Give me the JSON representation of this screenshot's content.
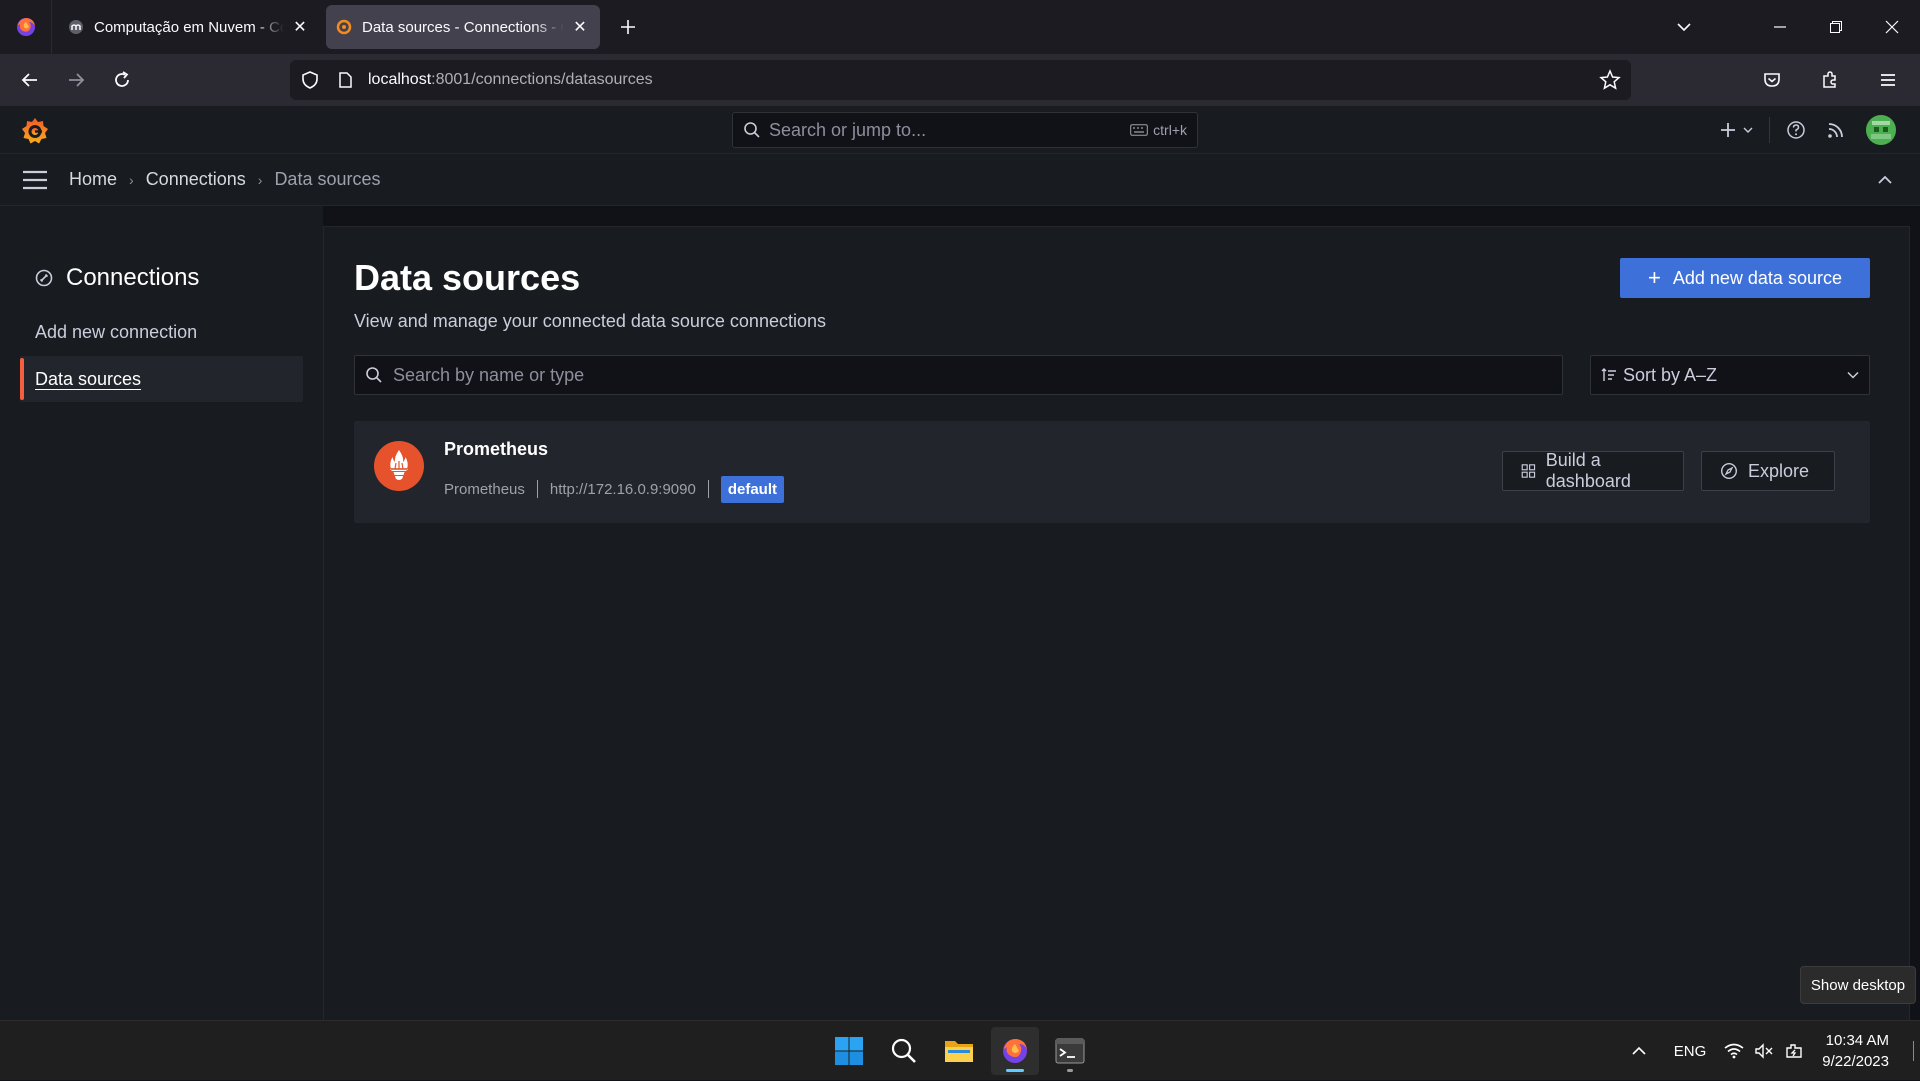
{
  "browser": {
    "tabs": [
      {
        "title": "Computação em Nuvem - Comp",
        "active": false
      },
      {
        "title": "Data sources - Connections - Grafana",
        "active": true
      }
    ],
    "url_host": "localhost",
    "url_path": ":8001/connections/datasources"
  },
  "grafana": {
    "search_placeholder": "Search or jump to...",
    "search_shortcut": "ctrl+k",
    "breadcrumbs": [
      "Home",
      "Connections",
      "Data sources"
    ],
    "sidebar": {
      "title": "Connections",
      "items": [
        {
          "label": "Add new connection",
          "active": false
        },
        {
          "label": "Data sources",
          "active": true
        }
      ]
    },
    "page": {
      "title": "Data sources",
      "subtitle": "View and manage your connected data source connections",
      "add_button": "Add new data source",
      "search_placeholder": "Search by name or type",
      "sort_label": "Sort by A–Z"
    },
    "datasources": [
      {
        "name": "Prometheus",
        "type": "Prometheus",
        "url": "http://172.16.0.9:9090",
        "badge": "default",
        "build_label": "Build a dashboard",
        "explore_label": "Explore"
      }
    ]
  },
  "tooltip": "Show desktop",
  "taskbar": {
    "language": "ENG",
    "time": "10:34 AM",
    "date": "9/22/2023"
  },
  "colors": {
    "accent_blue": "#3d71d9",
    "grafana_orange": "#f55f3e",
    "prometheus_red": "#e6522c"
  }
}
